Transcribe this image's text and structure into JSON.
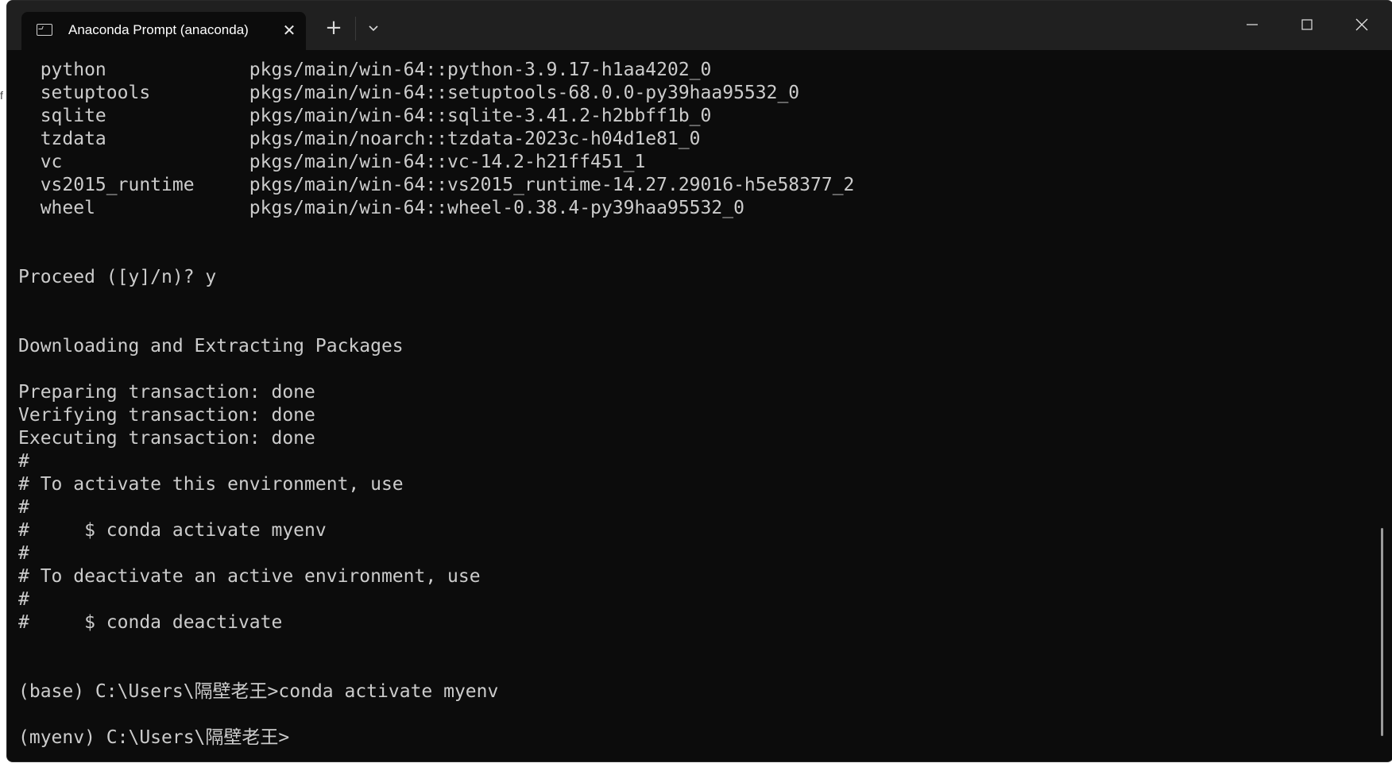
{
  "window": {
    "tab_title": "Anaconda Prompt (anaconda)",
    "tab_close_glyph": "✕",
    "new_tab_glyph": "+",
    "icons": {
      "tab": "terminal-icon",
      "close_tab": "close-icon",
      "new_tab": "plus-icon",
      "dropdown": "chevron-down-icon",
      "minimize": "minimize-icon",
      "maximize": "maximize-icon",
      "close_window": "close-icon"
    }
  },
  "edge_glyph": "f",
  "console": {
    "lines": [
      "  python             pkgs/main/win-64::python-3.9.17-h1aa4202_0",
      "  setuptools         pkgs/main/win-64::setuptools-68.0.0-py39haa95532_0",
      "  sqlite             pkgs/main/win-64::sqlite-3.41.2-h2bbff1b_0",
      "  tzdata             pkgs/main/noarch::tzdata-2023c-h04d1e81_0",
      "  vc                 pkgs/main/win-64::vc-14.2-h21ff451_1",
      "  vs2015_runtime     pkgs/main/win-64::vs2015_runtime-14.27.29016-h5e58377_2",
      "  wheel              pkgs/main/win-64::wheel-0.38.4-py39haa95532_0",
      "",
      "",
      "Proceed ([y]/n)? y",
      "",
      "",
      "Downloading and Extracting Packages",
      "",
      "Preparing transaction: done",
      "Verifying transaction: done",
      "Executing transaction: done",
      "#",
      "# To activate this environment, use",
      "#",
      "#     $ conda activate myenv",
      "#",
      "# To deactivate an active environment, use",
      "#",
      "#     $ conda deactivate",
      "",
      "",
      "(base) C:\\Users\\隔壁老王>conda activate myenv",
      "",
      "(myenv) C:\\Users\\隔壁老王>"
    ]
  },
  "colors": {
    "console_bg": "#0c0c0c",
    "console_text": "#cccccc",
    "titlebar_bg": "#202020"
  }
}
